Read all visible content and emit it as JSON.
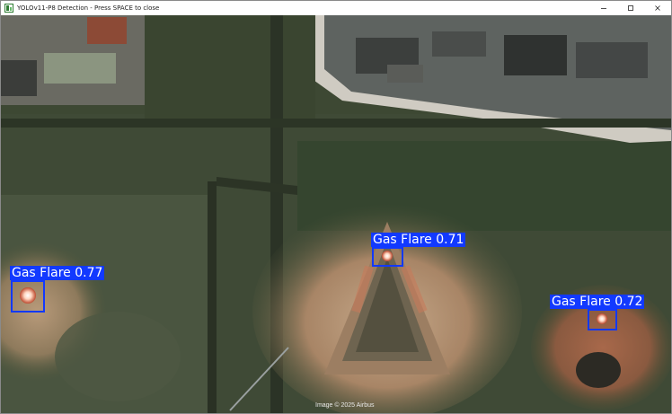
{
  "window": {
    "title": "YOLOv11-P8 Detection - Press SPACE to close"
  },
  "controls": {
    "minimize": "minimize-icon",
    "maximize": "maximize-icon",
    "close": "close-icon"
  },
  "colors": {
    "detection_box": "#1239ff",
    "label_text": "#ffffff"
  },
  "detections": [
    {
      "label": "Gas Flare 0.77",
      "class": "Gas Flare",
      "confidence": 0.77
    },
    {
      "label": "Gas Flare 0.71",
      "class": "Gas Flare",
      "confidence": 0.71
    },
    {
      "label": "Gas Flare 0.72",
      "class": "Gas Flare",
      "confidence": 0.72
    }
  ],
  "image": {
    "credit": "Image © 2025 Airbus"
  }
}
